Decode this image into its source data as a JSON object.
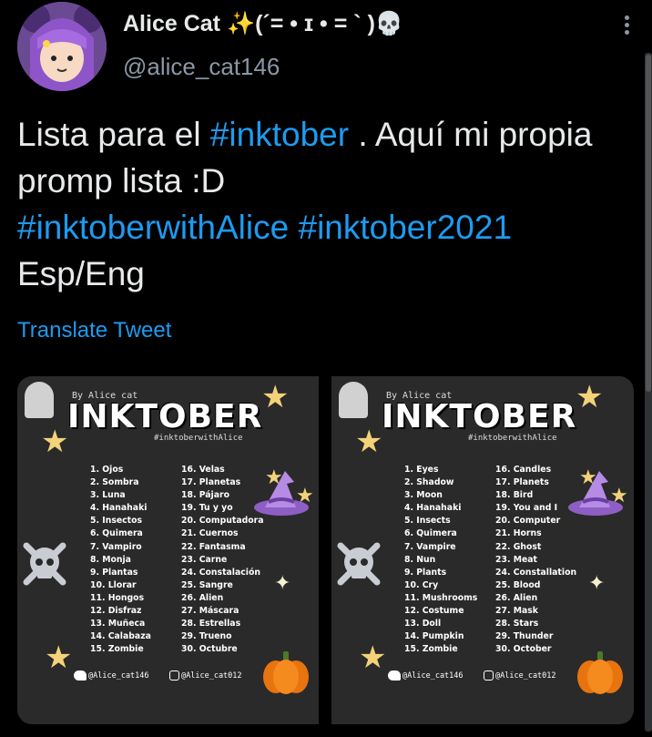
{
  "author": {
    "display_name": "Alice Cat",
    "kaomoji": "(´= • ɪ • = ` )",
    "handle": "@alice_cat146"
  },
  "tweet": {
    "text_1": "Lista para el ",
    "tag_1": "#inktober",
    "text_2": " . Aquí mi propia promp lista :D",
    "tag_2": "#inktoberwithAlice",
    "tag_3": "#inktober2021",
    "text_3": "Esp/Eng",
    "translate_label": "Translate Tweet"
  },
  "images": [
    {
      "byline": "By Alice cat",
      "title": "INKTOBER",
      "hashtag": "#inktoberwithAlice",
      "col1": [
        "1. Ojos",
        "2. Sombra",
        "3. Luna",
        "4. Hanahaki",
        "5. Insectos",
        "6. Quimera",
        "7. Vampiro",
        "8. Monja",
        "9. Plantas",
        "10. Llorar",
        "11. Hongos",
        "12. Disfraz",
        "13. Muñeca",
        "14. Calabaza",
        "15. Zombie"
      ],
      "col2": [
        "16. Velas",
        "17. Planetas",
        "18. Pájaro",
        "19. Tu y yo",
        "20. Computadora",
        "21. Cuernos",
        "22. Fantasma",
        "23. Carne",
        "24. Constalación",
        "25. Sangre",
        "26. Alien",
        "27. Máscara",
        "28. Estrellas",
        "29. Trueno",
        "30. Octubre"
      ],
      "twitter": "@Alice_cat146",
      "instagram": "@Alice_cat012"
    },
    {
      "byline": "By Alice cat",
      "title": "INKTOBER",
      "hashtag": "#inktoberwithAlice",
      "col1": [
        "1. Eyes",
        "2. Shadow",
        "3. Moon",
        "4. Hanahaki",
        "5. Insects",
        "6. Quimera",
        "7. Vampire",
        "8. Nun",
        "9. Plants",
        "10. Cry",
        "11. Mushrooms",
        "12. Costume",
        "13. Doll",
        "14. Pumpkin",
        "15. Zombie"
      ],
      "col2": [
        "16. Candles",
        "17. Planets",
        "18. Bird",
        "19. You and I",
        "20. Computer",
        "21. Horns",
        "22. Ghost",
        "23. Meat",
        "24. Constallation",
        "25. Blood",
        "26. Alien",
        "27. Mask",
        "28. Stars",
        "29. Thunder",
        "30. October"
      ],
      "twitter": "@Alice_cat146",
      "instagram": "@Alice_cat012"
    }
  ],
  "colors": {
    "background": "#000000",
    "link": "#1d9bf0",
    "text": "#e7e9ea",
    "muted": "#8b98a5",
    "card": "#2b2a2a"
  }
}
